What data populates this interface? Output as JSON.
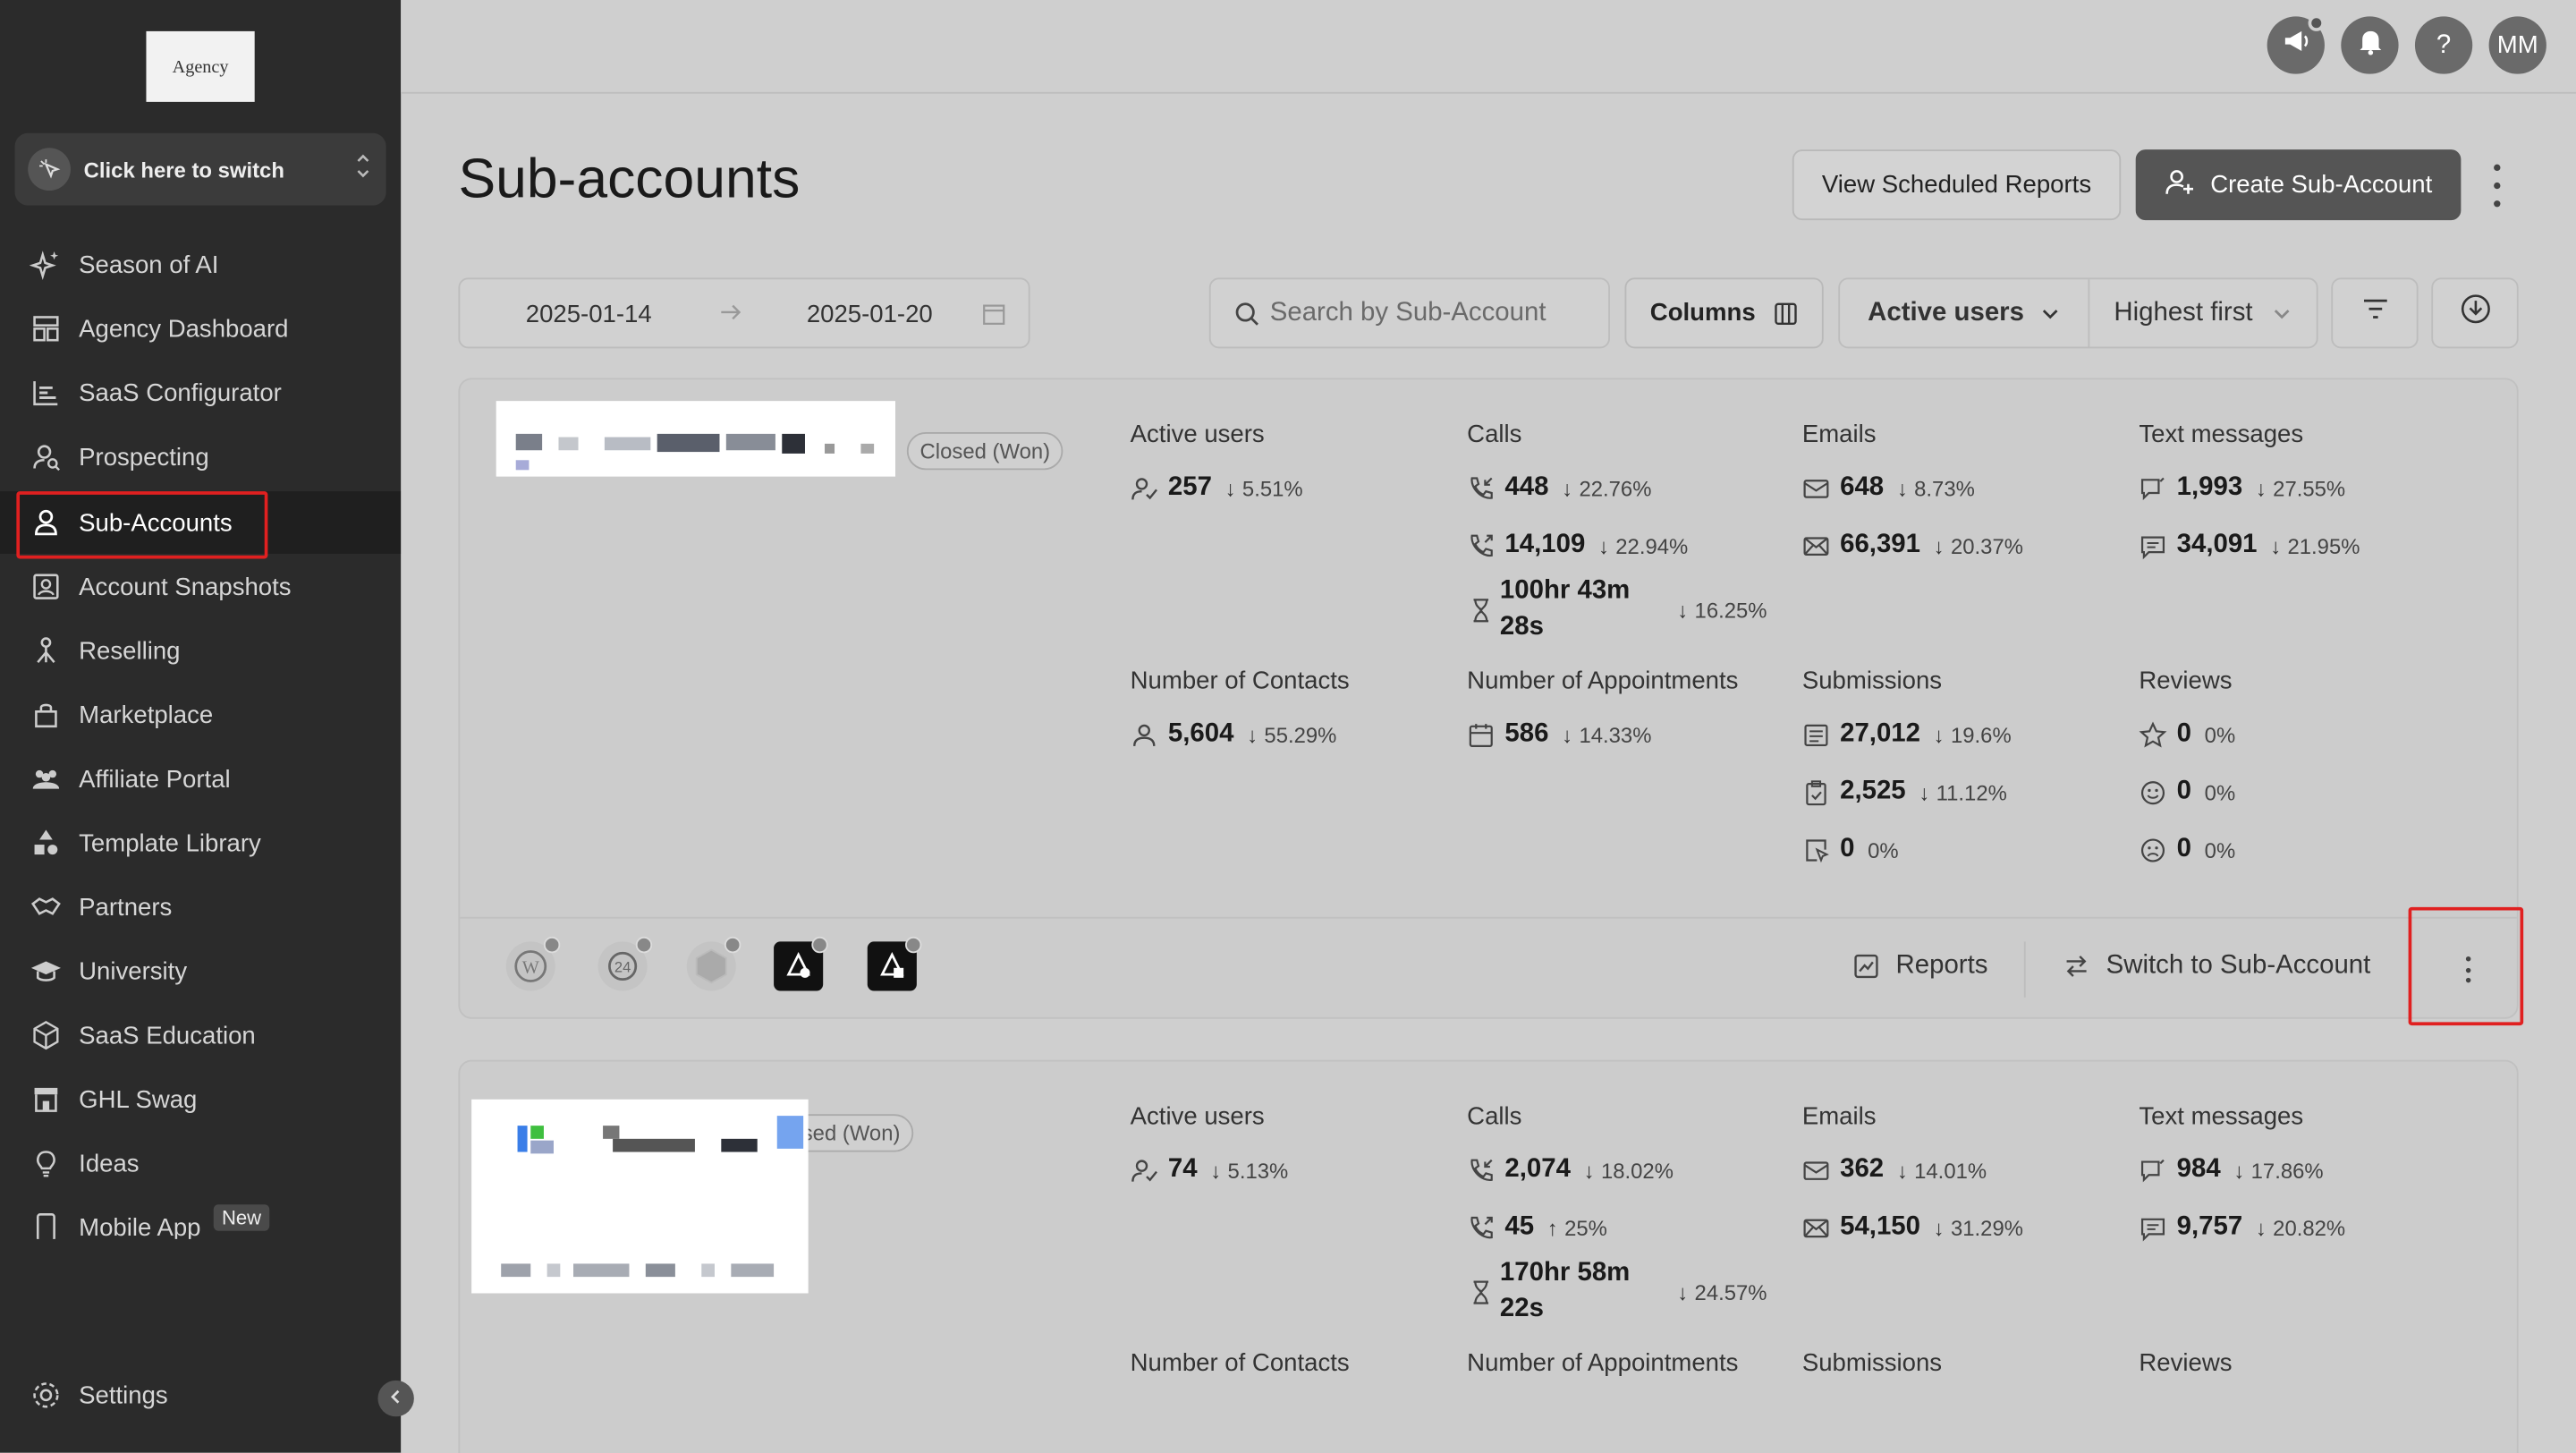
{
  "sidebar": {
    "logo_text": "Agency",
    "switcher_label": "Click here to switch",
    "items": [
      {
        "label": "Season of AI",
        "icon": "sparkle-icon"
      },
      {
        "label": "Agency Dashboard",
        "icon": "dashboard-icon"
      },
      {
        "label": "SaaS Configurator",
        "icon": "bar-chart-icon"
      },
      {
        "label": "Prospecting",
        "icon": "user-search-icon"
      },
      {
        "label": "Sub-Accounts",
        "icon": "user-icon"
      },
      {
        "label": "Account Snapshots",
        "icon": "snapshot-icon"
      },
      {
        "label": "Reselling",
        "icon": "network-icon"
      },
      {
        "label": "Marketplace",
        "icon": "bag-icon"
      },
      {
        "label": "Affiliate Portal",
        "icon": "users-icon"
      },
      {
        "label": "Template Library",
        "icon": "shapes-icon"
      },
      {
        "label": "Partners",
        "icon": "handshake-icon"
      },
      {
        "label": "University",
        "icon": "graduation-cap-icon"
      },
      {
        "label": "SaaS Education",
        "icon": "box-icon"
      },
      {
        "label": "GHL Swag",
        "icon": "store-icon"
      },
      {
        "label": "Ideas",
        "icon": "lightbulb-icon"
      },
      {
        "label": "Mobile App",
        "icon": "phone-icon"
      }
    ],
    "active_item": "Sub-Accounts",
    "new_badge": "New",
    "settings_label": "Settings"
  },
  "topbar": {
    "avatar_initials": "MM",
    "help_label": "?"
  },
  "header": {
    "title": "Sub-accounts",
    "view_scheduled_label": "View Scheduled Reports",
    "create_label": "Create Sub-Account"
  },
  "filters": {
    "date_start": "2025-01-14",
    "date_end": "2025-01-20",
    "search_placeholder": "Search by Sub-Account",
    "columns_label": "Columns",
    "sort_metric": "Active users",
    "sort_order": "Highest first"
  },
  "accounts": [
    {
      "status": "Closed (Won)",
      "active_users": {
        "title": "Active users",
        "value": "257",
        "change": "5.51%"
      },
      "calls": {
        "title": "Calls",
        "inbound": "448",
        "inbound_change": "22.76%",
        "outbound": "14,109",
        "outbound_change": "22.94%",
        "duration_line1": "100hr 43m",
        "duration_line2": "28s",
        "duration_change": "16.25%"
      },
      "emails": {
        "title": "Emails",
        "opened": "648",
        "opened_change": "8.73%",
        "sent": "66,391",
        "sent_change": "20.37%"
      },
      "texts": {
        "title": "Text messages",
        "inbound": "1,993",
        "inbound_change": "27.55%",
        "outbound": "34,091",
        "outbound_change": "21.95%"
      },
      "contacts": {
        "title": "Number of Contacts",
        "value": "5,604",
        "change": "55.29%"
      },
      "appointments": {
        "title": "Number of Appointments",
        "value": "586",
        "change": "14.33%"
      },
      "submissions": {
        "title": "Submissions",
        "forms": "27,012",
        "forms_change": "19.6%",
        "surveys": "2,525",
        "surveys_change": "11.12%",
        "other": "0",
        "other_change": "0%"
      },
      "reviews": {
        "title": "Reviews",
        "stars": "0",
        "stars_change": "0%",
        "positive": "0",
        "positive_change": "0%",
        "negative": "0",
        "negative_change": "0%"
      },
      "reports_label": "Reports",
      "switch_label": "Switch to Sub-Account"
    },
    {
      "status": "osed (Won)",
      "active_users": {
        "title": "Active users",
        "value": "74",
        "change": "5.13%"
      },
      "calls": {
        "title": "Calls",
        "inbound": "2,074",
        "inbound_change": "18.02%",
        "outbound": "45",
        "outbound_change": "25%",
        "duration_line1": "170hr 58m",
        "duration_line2": "22s",
        "duration_change": "24.57%"
      },
      "emails": {
        "title": "Emails",
        "opened": "362",
        "opened_change": "14.01%",
        "sent": "54,150",
        "sent_change": "31.29%"
      },
      "texts": {
        "title": "Text messages",
        "inbound": "984",
        "inbound_change": "17.86%",
        "outbound": "9,757",
        "outbound_change": "20.82%"
      },
      "contacts": {
        "title": "Number of Contacts"
      },
      "appointments": {
        "title": "Number of Appointments"
      },
      "submissions": {
        "title": "Submissions"
      },
      "reviews": {
        "title": "Reviews"
      }
    }
  ],
  "arrows": {
    "down": "↓",
    "up": "↑"
  }
}
